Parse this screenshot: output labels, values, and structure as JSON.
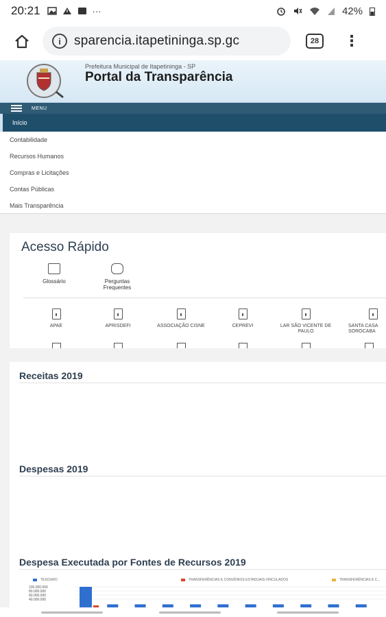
{
  "status_bar": {
    "time": "20:21",
    "icons": [
      "image-icon",
      "warning-icon",
      "notification-icon",
      "more-icon"
    ],
    "more": "···",
    "battery": "42%"
  },
  "browser": {
    "url": "sparencia.itapetininga.sp.gc",
    "tab_count": "28"
  },
  "site": {
    "subtitle": "Prefeitura Municipal de Itapetininga - SP",
    "title": "Portal da Transparência"
  },
  "menu": {
    "label": "MENU",
    "items": [
      {
        "label": "Início",
        "active": true
      },
      {
        "label": "Contabilidade"
      },
      {
        "label": "Recursos Humanos"
      },
      {
        "label": "Compras e Licitações"
      },
      {
        "label": "Contas Públicas"
      },
      {
        "label": "Mais Transparência"
      }
    ]
  },
  "acesso_rapido": {
    "title": "Acesso Rápido",
    "quick_links": [
      {
        "label": "Glossário",
        "icon": "glossary-icon"
      },
      {
        "label": "Perguntas Frequentes",
        "icon": "faq-icon"
      }
    ],
    "entities": [
      {
        "label": "APAE"
      },
      {
        "label": "APRISDEFI"
      },
      {
        "label": "ASSOCIAÇÃO CISNE"
      },
      {
        "label": "CEPREVI"
      },
      {
        "label": "LAR SÃO VICENTE DE PAULO"
      },
      {
        "label": "SANTA CASA SOROCABA"
      }
    ]
  },
  "sections": {
    "receitas": "Receitas 2019",
    "despesas": "Despesas 2019",
    "fontes": "Despesa Executada por Fontes de Recursos 2019"
  },
  "chart_data": {
    "type": "bar",
    "title": "Despesa Executada por Fontes de Recursos 2019",
    "series": [
      {
        "name": "TESOURO",
        "color": "#2f6fd0"
      },
      {
        "name": "TRANSFERÊNCIAS E CONVÊNIOS ESTADUAIS-VINCULADOS",
        "color": "#d9472b"
      },
      {
        "name": "TRANSFERÊNCIAS E C...",
        "color": "#e8b43a"
      }
    ],
    "y_ticks": [
      "100.000.000",
      "80.000.000",
      "60.000.000",
      "40.000.000"
    ],
    "values": [
      100000000,
      8000000,
      6000000,
      4000000,
      3000000,
      3000000,
      3000000,
      8000000,
      3000000,
      3000000,
      3000000
    ],
    "ylim": [
      40000000,
      100000000
    ]
  }
}
